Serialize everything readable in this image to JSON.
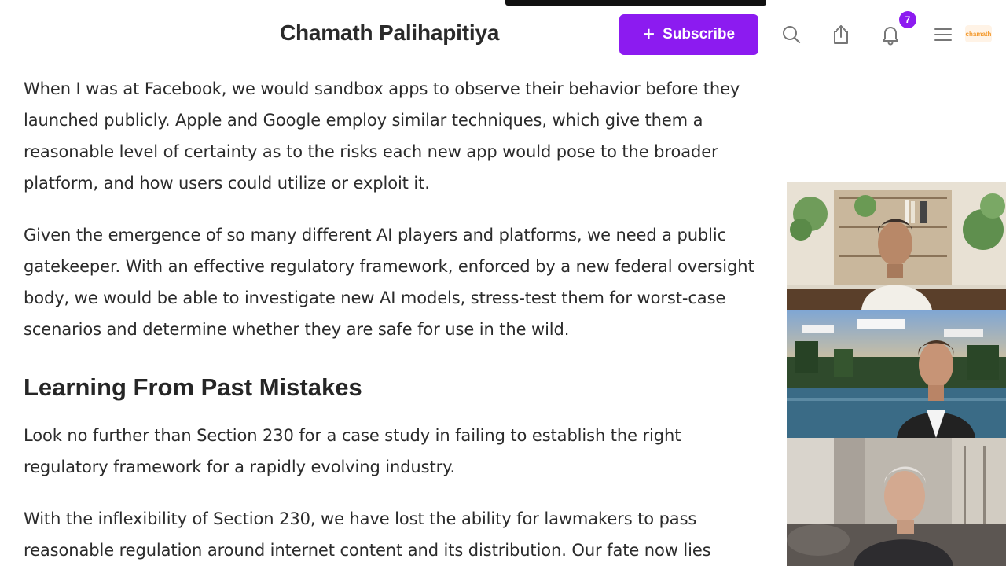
{
  "header": {
    "publication_title": "Chamath Palihapitiya",
    "subscribe_label": "Subscribe",
    "notification_count": "7",
    "avatar_text": "chamath"
  },
  "icons": {
    "search": "search-icon",
    "share": "share-icon",
    "notifications": "bell-icon",
    "menu": "menu-icon",
    "subscribe": "plus-icon"
  },
  "colors": {
    "accent": "#8c1bf0",
    "text": "#2b2b2b"
  },
  "article": {
    "p1": "When I was at Facebook, we would sandbox apps to observe their behavior before they launched publicly. Apple and Google employ similar techniques, which give them a reasonable level of certainty as to the risks each new app would pose to the broader platform, and how users could utilize or exploit it.",
    "p2": "Given the emergence of so many different AI players and platforms, we need a public gatekeeper. With an effective regulatory framework, enforced by a new federal oversight body, we would be able to investigate new AI models, stress-test them for worst-case scenarios and determine whether they are safe for use in the wild.",
    "h2": "Learning From Past Mistakes",
    "p3": "Look no further than Section 230 for a case study in failing to establish the right regulatory framework for a rapidly evolving industry.",
    "p4": "With the inflexibility of Section 230, we have lost the ability for lawmakers to pass reasonable regulation around internet content and its distribution. Our fate now lies"
  },
  "video_call": {
    "participants": [
      {
        "tile": "participant-1"
      },
      {
        "tile": "participant-2"
      },
      {
        "tile": "participant-3"
      }
    ]
  }
}
